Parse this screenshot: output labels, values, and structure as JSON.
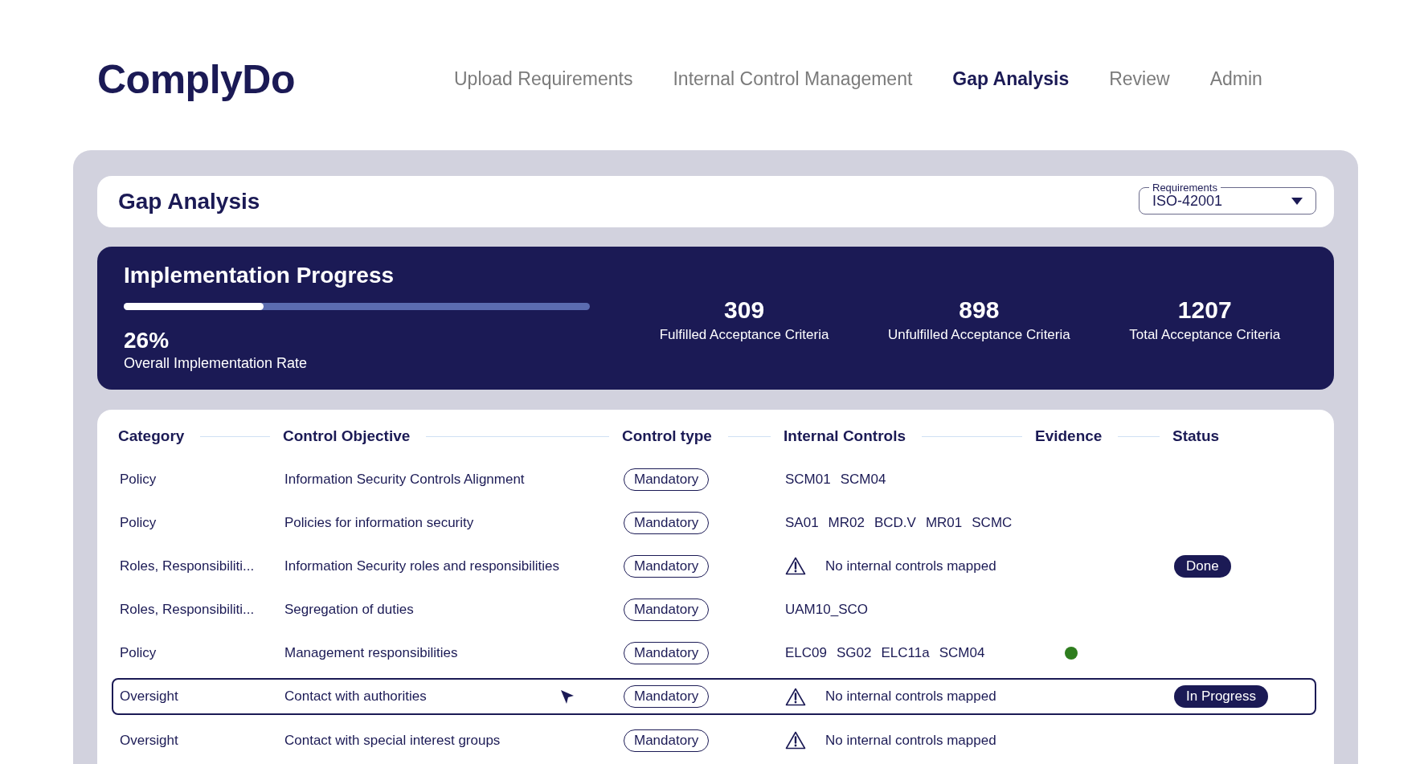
{
  "logo": {
    "text": "ComplyDo"
  },
  "nav": [
    {
      "label": "Upload Requirements",
      "selected": false
    },
    {
      "label": "Internal Control Management",
      "selected": false
    },
    {
      "label": "Gap Analysis",
      "selected": true
    },
    {
      "label": "Review",
      "selected": false
    },
    {
      "label": "Admin",
      "selected": false
    }
  ],
  "page_title": "Gap Analysis",
  "requirements_select": {
    "label": "Requirements",
    "value": "ISO-42001"
  },
  "progress": {
    "title": "Implementation Progress",
    "level": 0.3,
    "percent": "26%",
    "caption": "Overall Implementation Rate",
    "stats": [
      {
        "value": "309",
        "label": "Fulfilled Acceptance Criteria"
      },
      {
        "value": "898",
        "label": "Unfulfilled Acceptance Criteria"
      },
      {
        "value": "1207",
        "label": "Total Acceptance Criteria"
      }
    ]
  },
  "table": {
    "columns": [
      "Category",
      "Control Objective",
      "Control type",
      "Internal Controls",
      "Evidence",
      "Status"
    ],
    "rows": [
      {
        "category": "Policy",
        "objective": "Information Security Controls Alignment",
        "type": "Mandatory",
        "controls": [
          "SCM01",
          "SCM04"
        ],
        "selected": false
      },
      {
        "category": "Policy",
        "objective": "Policies for information security",
        "type": "Mandatory",
        "controls": [
          "SA01",
          "MR02",
          "BCD.V",
          "MR01",
          "SCMC"
        ],
        "selected": false
      },
      {
        "category": "Roles, Responsibiliti...",
        "objective": "Information Security roles and responsibilities",
        "type": "Mandatory",
        "warning": "No internal controls mapped",
        "status": "Done",
        "selected": false
      },
      {
        "category": "Roles, Responsibiliti...",
        "objective": "Segregation of duties",
        "type": "Mandatory",
        "controls": [
          "UAM10_SCO"
        ],
        "selected": false
      },
      {
        "category": "Policy",
        "objective": "Management responsibilities",
        "type": "Mandatory",
        "controls": [
          "ELC09",
          "SG02",
          "ELC11a",
          "SCM04"
        ],
        "evidence": {
          "color": "#2e7d1e"
        },
        "selected": false
      },
      {
        "category": "Oversight",
        "objective": "Contact with authorities",
        "type": "Mandatory",
        "warning": "No internal controls mapped",
        "status": "In Progress",
        "selected": true
      },
      {
        "category": "Oversight",
        "objective": "Contact with special interest groups",
        "type": "Mandatory",
        "warning": "No internal controls mapped",
        "selected": false
      }
    ]
  }
}
